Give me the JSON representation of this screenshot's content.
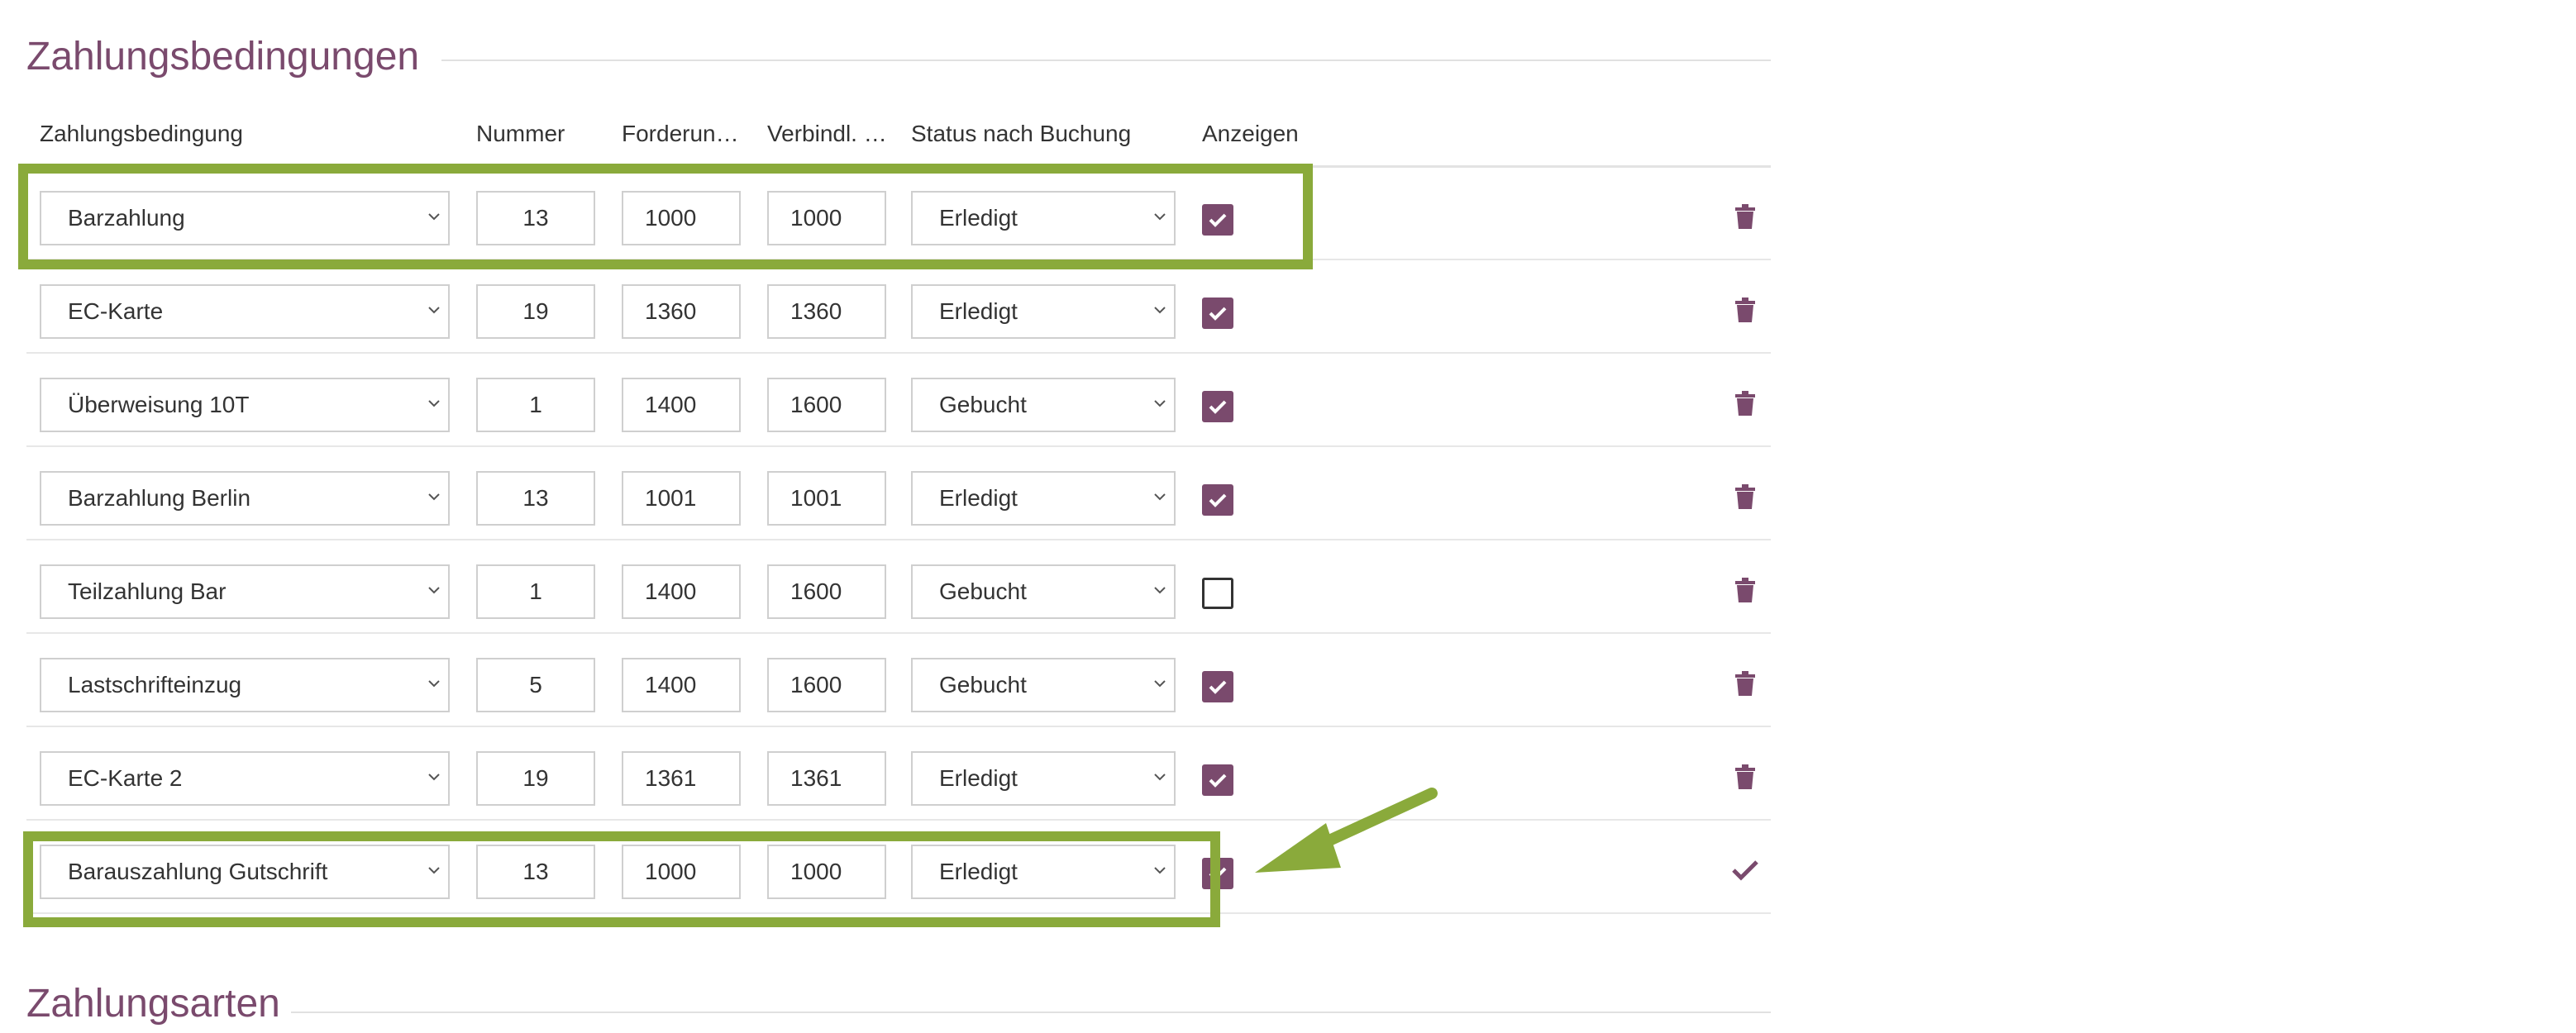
{
  "section": {
    "title": "Zahlungsbedingungen",
    "next_title": "Zahlungsarten"
  },
  "columns": {
    "name": "Zahlungsbedingung",
    "number": "Nummer",
    "forderung": "Forderun…",
    "verbindl": "Verbindl. …",
    "status": "Status nach Buchung",
    "show": "Anzeigen"
  },
  "rows": [
    {
      "name": "Barzahlung",
      "number": "13",
      "forderung": "1000",
      "verbindl": "1000",
      "status": "Erledigt",
      "show": true,
      "action": "trash-icon"
    },
    {
      "name": "EC-Karte",
      "number": "19",
      "forderung": "1360",
      "verbindl": "1360",
      "status": "Erledigt",
      "show": true,
      "action": "trash-icon"
    },
    {
      "name": "Überweisung 10T",
      "number": "1",
      "forderung": "1400",
      "verbindl": "1600",
      "status": "Gebucht",
      "show": true,
      "action": "trash-icon"
    },
    {
      "name": "Barzahlung Berlin",
      "number": "13",
      "forderung": "1001",
      "verbindl": "1001",
      "status": "Erledigt",
      "show": true,
      "action": "trash-icon"
    },
    {
      "name": "Teilzahlung Bar",
      "number": "1",
      "forderung": "1400",
      "verbindl": "1600",
      "status": "Gebucht",
      "show": false,
      "action": "trash-icon"
    },
    {
      "name": "Lastschrifteinzug",
      "number": "5",
      "forderung": "1400",
      "verbindl": "1600",
      "status": "Gebucht",
      "show": true,
      "action": "trash-icon"
    },
    {
      "name": "EC-Karte 2",
      "number": "19",
      "forderung": "1361",
      "verbindl": "1361",
      "status": "Erledigt",
      "show": true,
      "action": "trash-icon"
    },
    {
      "name": "Barauszahlung Gutschrift",
      "number": "13",
      "forderung": "1000",
      "verbindl": "1000",
      "status": "Erledigt",
      "show": true,
      "action": "checkmark-icon"
    }
  ],
  "colors": {
    "accent": "#7a4a6d",
    "highlight": "#8aaa3b"
  }
}
